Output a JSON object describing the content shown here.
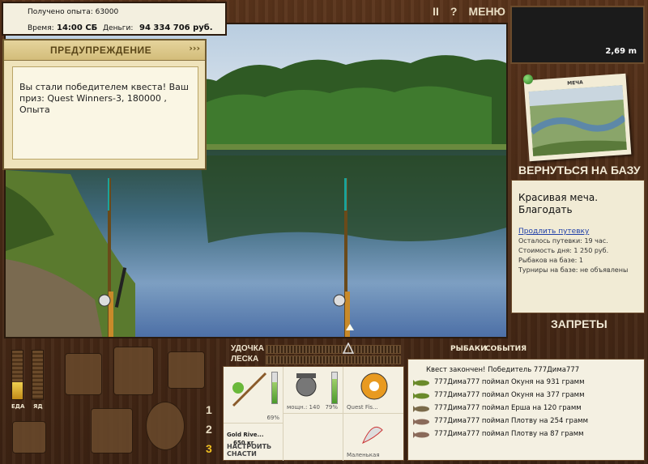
{
  "stats": {
    "experience": "Получено опыта: 63000",
    "time_label": "Время:",
    "time_value": "14:00 СБ",
    "money_label": "Деньги:",
    "money_value": "94 334 706 руб."
  },
  "top_menu": {
    "pause": "II",
    "help": "?",
    "menu": "МЕНЮ"
  },
  "warning": {
    "title": "ПРЕДУПРЕЖДЕНИЕ",
    "arrows": "›››",
    "message": "Вы стали победителем квеста! Ваш приз: Quest Winners-3, 180000 , Опыта"
  },
  "depth": "2,69 m",
  "photo_title": "МЕЧА",
  "return_button": "ВЕРНУТЬСЯ НА БАЗУ",
  "base_info": {
    "name": "Красивая меча. Благодать",
    "extend_link": "Продлить путевку",
    "lines": [
      "Осталось путевки: 19 час.",
      "Стоимость дня: 1 250 руб.",
      "Рыбаков на базе: 1",
      "Турниры на базе: не объявлены"
    ]
  },
  "bans_button": "ЗАПРЕТЫ",
  "rod_label": "УДОЧКА",
  "line_label": "ЛЕСКА",
  "tabs": {
    "fishers": "РЫБАКИ",
    "events": "СОБЫТИЯ"
  },
  "gauges": {
    "food": "ЕДА",
    "poison": "ЯД",
    "food_level": 0.35,
    "poison_level": 0.0
  },
  "slot_numbers": [
    "1",
    "2",
    "3"
  ],
  "tackle": {
    "rod_name": "Gold Rive...",
    "rod_weight": "650 кг",
    "rod_pct": "69%",
    "reel_power": "мощн.: 140",
    "reel_pct": "79%",
    "line_name": "Quest Fis...",
    "lure_name": "Маленькая",
    "setup_button": "НАСТРОИТЬ СНАСТИ",
    "rod_level": 0.69,
    "reel_level": 0.79,
    "line_level": 0.7
  },
  "events": [
    "Квест закончен! Победитель 777Дима777",
    "777Дима777 поймал Окуня на 931 грамм",
    "777Дима777 поймал Окуня на 377 грамм",
    "777Дима777 поймал Ерша на 120 грамм",
    "777Дима777 поймал Плотву на 254 грамм",
    "777Дима777 поймал Плотву на 87 грамм"
  ],
  "event_fish": [
    "",
    "perch",
    "perch",
    "ruffe",
    "roach",
    "roach"
  ],
  "colors": {
    "wood": "#4a2b17",
    "panel": "#f4f0e2",
    "link": "#1f3fa8"
  }
}
